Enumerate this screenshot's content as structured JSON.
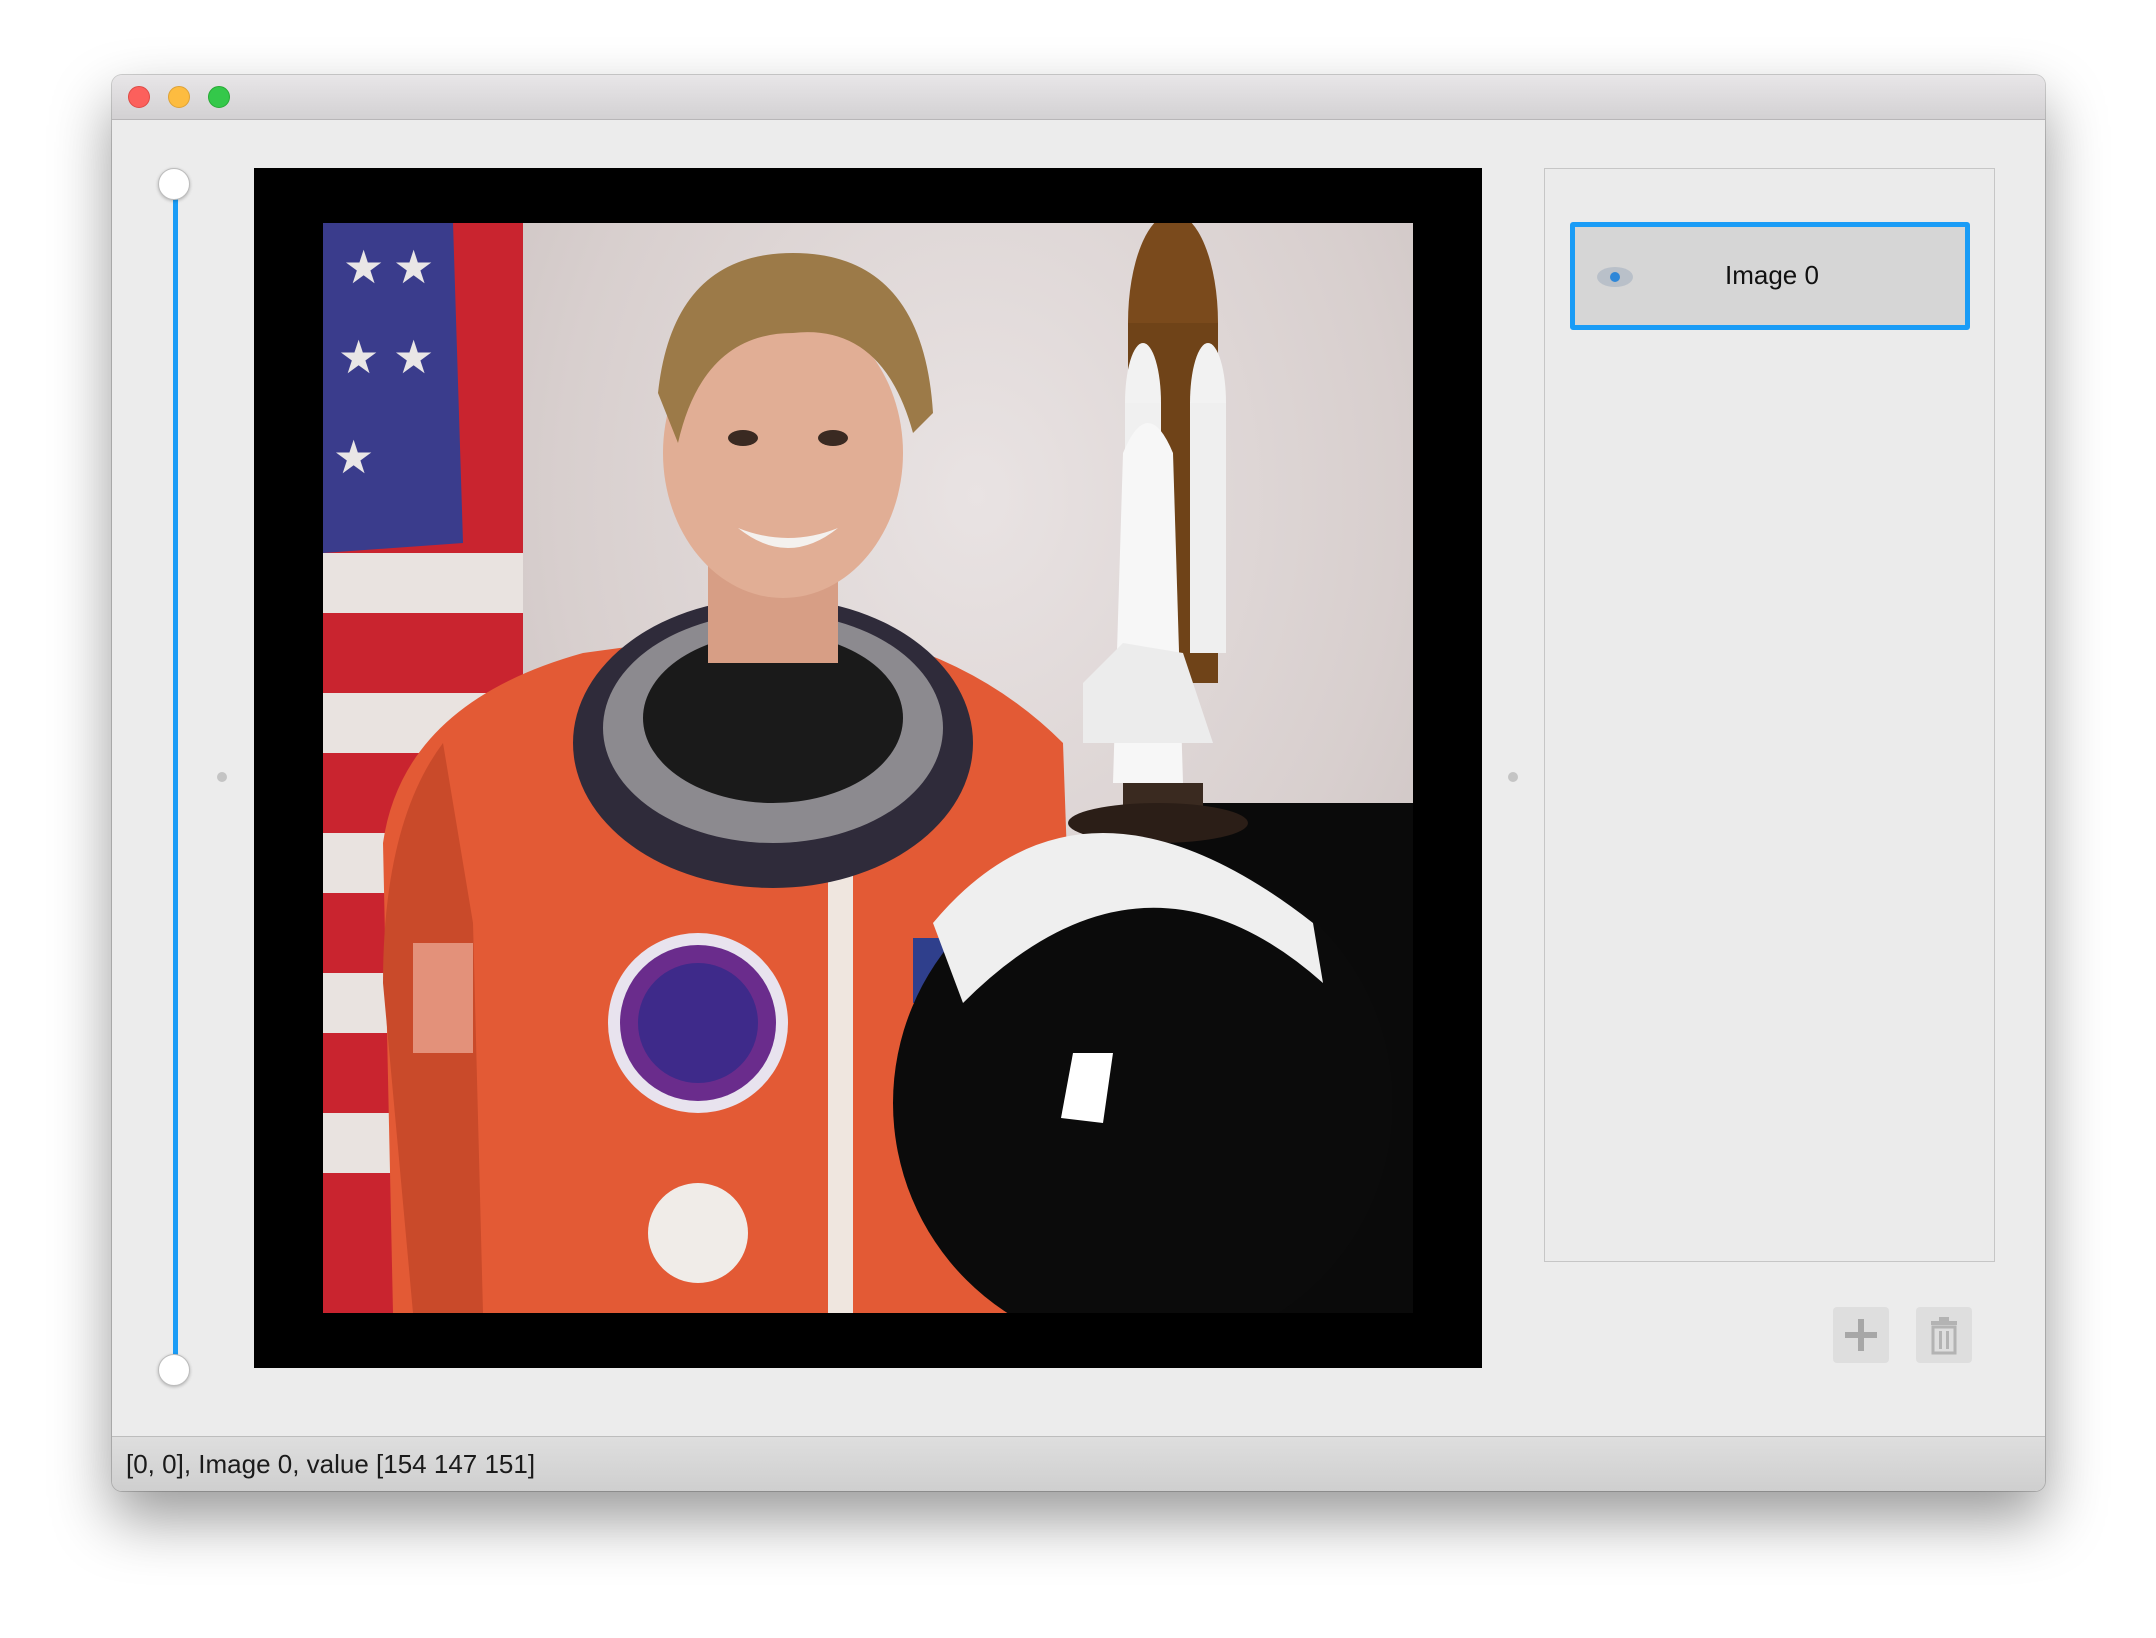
{
  "window": {
    "buttons": [
      "close",
      "minimize",
      "zoom"
    ]
  },
  "slider": {
    "orientation": "vertical",
    "range_fraction": [
      0.0,
      1.0
    ]
  },
  "canvas": {
    "image_name": "Image 0",
    "image_description_icon": "astronaut-photo"
  },
  "layers": {
    "items": [
      {
        "label": "Image 0",
        "visible": true,
        "selected": true
      }
    ]
  },
  "toolbar": {
    "add_icon": "plus-icon",
    "delete_icon": "trash-icon"
  },
  "status": {
    "text": "[0, 0], Image 0, value [154 147 151]"
  },
  "colors": {
    "accent": "#1a9cf6",
    "window_bg": "#ececec",
    "canvas_bg": "#000000"
  }
}
